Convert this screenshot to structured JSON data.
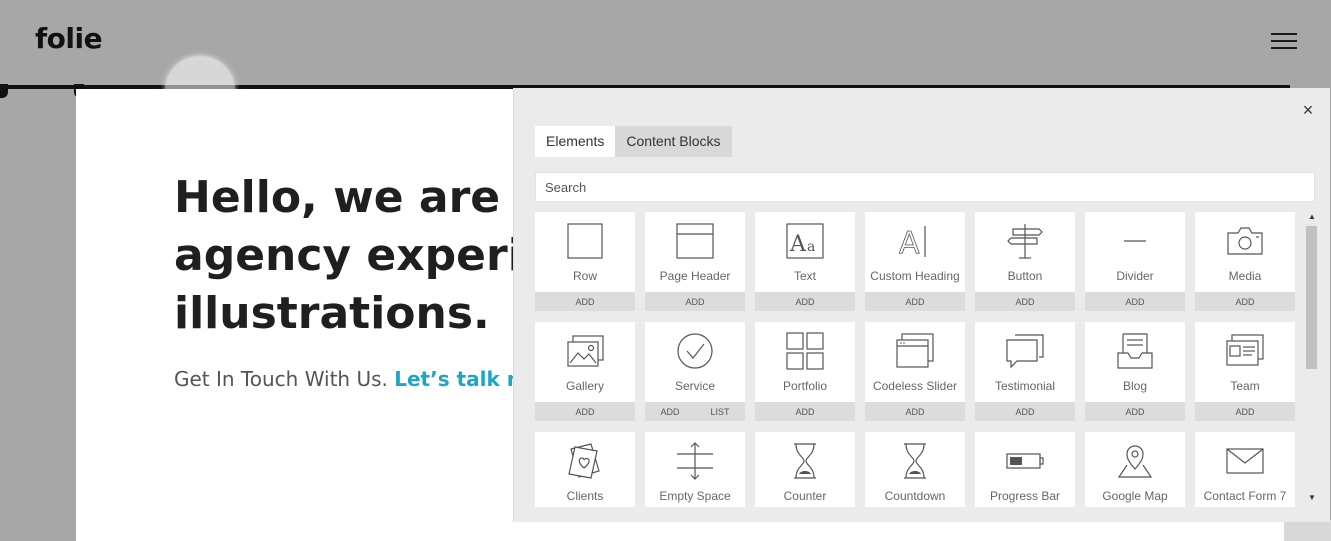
{
  "site": {
    "logo": "folie",
    "hero_line1": "Hello, we are a",
    "hero_line2": "agency experie",
    "hero_line3": "illustrations.",
    "sub_text": "Get In Touch With Us.",
    "sub_link": "Let’s talk n"
  },
  "panel": {
    "close_glyph": "×",
    "tabs": [
      {
        "label": "Elements",
        "active": true
      },
      {
        "label": "Content Blocks",
        "active": false
      }
    ],
    "search_placeholder": "Search",
    "scroll_up": "▲",
    "scroll_down": "▼",
    "elements": [
      {
        "label": "Row",
        "icon": "row-icon",
        "actions": [
          "ADD"
        ]
      },
      {
        "label": "Page Header",
        "icon": "page-header-icon",
        "actions": [
          "ADD"
        ]
      },
      {
        "label": "Text",
        "icon": "text-icon",
        "actions": [
          "ADD"
        ]
      },
      {
        "label": "Custom Heading",
        "icon": "custom-heading-icon",
        "actions": [
          "ADD"
        ]
      },
      {
        "label": "Button",
        "icon": "signpost-icon",
        "actions": [
          "ADD"
        ]
      },
      {
        "label": "Divider",
        "icon": "divider-icon",
        "actions": [
          "ADD"
        ]
      },
      {
        "label": "Media",
        "icon": "camera-icon",
        "actions": [
          "ADD"
        ]
      },
      {
        "label": "Gallery",
        "icon": "gallery-icon",
        "actions": [
          "ADD"
        ]
      },
      {
        "label": "Service",
        "icon": "check-circle-icon",
        "actions": [
          "ADD",
          "LIST"
        ]
      },
      {
        "label": "Portfolio",
        "icon": "grid-icon",
        "actions": [
          "ADD"
        ]
      },
      {
        "label": "Codeless Slider",
        "icon": "slider-icon",
        "actions": [
          "ADD"
        ]
      },
      {
        "label": "Testimonial",
        "icon": "speech-bubbles-icon",
        "actions": [
          "ADD"
        ]
      },
      {
        "label": "Blog",
        "icon": "inbox-icon",
        "actions": [
          "ADD"
        ]
      },
      {
        "label": "Team",
        "icon": "id-cards-icon",
        "actions": [
          "ADD"
        ]
      },
      {
        "label": "Clients",
        "icon": "cards-heart-icon",
        "actions": []
      },
      {
        "label": "Empty Space",
        "icon": "empty-space-icon",
        "actions": []
      },
      {
        "label": "Counter",
        "icon": "hourglass-icon",
        "actions": []
      },
      {
        "label": "Countdown",
        "icon": "hourglass-icon",
        "actions": []
      },
      {
        "label": "Progress Bar",
        "icon": "battery-icon",
        "actions": []
      },
      {
        "label": "Google Map",
        "icon": "map-pin-icon",
        "actions": []
      },
      {
        "label": "Contact Form 7",
        "icon": "envelope-icon",
        "actions": []
      }
    ]
  }
}
